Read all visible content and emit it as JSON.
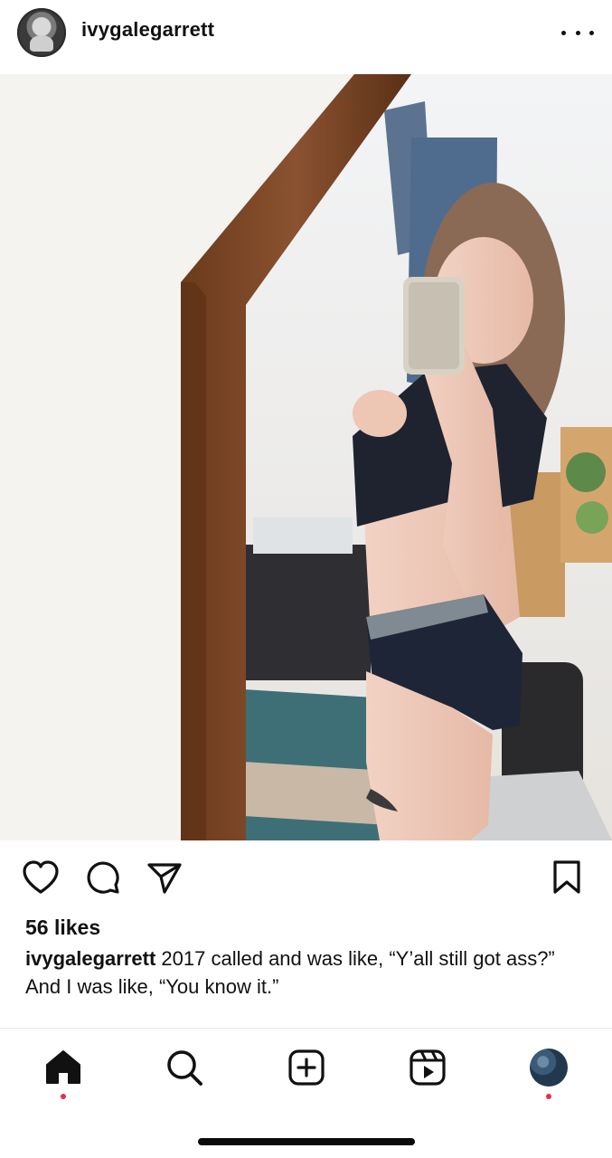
{
  "post": {
    "username": "ivygalegarrett",
    "likes": "56 likes",
    "caption_user": "ivygalegarrett",
    "caption_text": "2017 called and was like, “Y’all still got ass?”",
    "caption_line2": "And I was like, “You know it.”"
  },
  "icons": {
    "header": [
      "avatar",
      "more-icon"
    ],
    "actions": [
      "heart-icon",
      "comment-icon",
      "share-icon",
      "bookmark-icon"
    ],
    "nav": [
      "home-icon",
      "search-icon",
      "new-post-icon",
      "reels-icon",
      "profile-avatar"
    ]
  },
  "colors": {
    "notification_dot": "#ee2b45",
    "text": "#111111",
    "background": "#ffffff"
  }
}
